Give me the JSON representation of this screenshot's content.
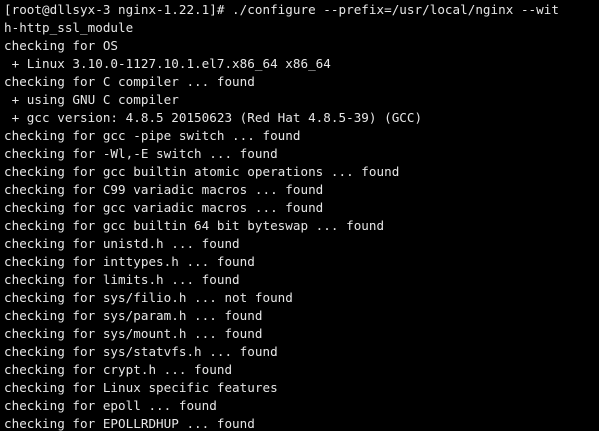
{
  "terminal": {
    "lines": [
      "[root@dllsyx-3 nginx-1.22.1]# ./configure --prefix=/usr/local/nginx --wit",
      "h-http_ssl_module",
      "checking for OS",
      " + Linux 3.10.0-1127.10.1.el7.x86_64 x86_64",
      "checking for C compiler ... found",
      " + using GNU C compiler",
      " + gcc version: 4.8.5 20150623 (Red Hat 4.8.5-39) (GCC)",
      "checking for gcc -pipe switch ... found",
      "checking for -Wl,-E switch ... found",
      "checking for gcc builtin atomic operations ... found",
      "checking for C99 variadic macros ... found",
      "checking for gcc variadic macros ... found",
      "checking for gcc builtin 64 bit byteswap ... found",
      "checking for unistd.h ... found",
      "checking for inttypes.h ... found",
      "checking for limits.h ... found",
      "checking for sys/filio.h ... not found",
      "checking for sys/param.h ... found",
      "checking for sys/mount.h ... found",
      "checking for sys/statvfs.h ... found",
      "checking for crypt.h ... found",
      "checking for Linux specific features",
      "checking for epoll ... found",
      "checking for EPOLLRDHUP ... found"
    ]
  }
}
